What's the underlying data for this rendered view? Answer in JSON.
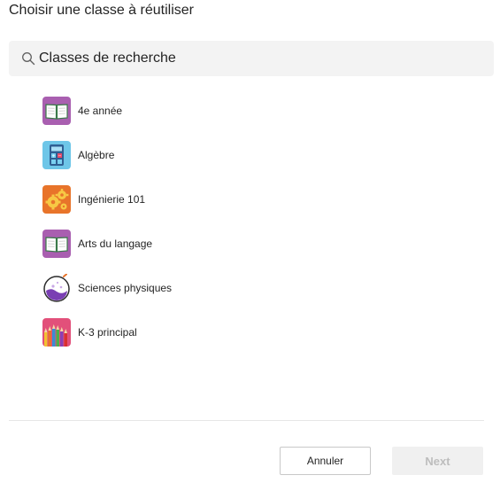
{
  "dialog": {
    "title": "Choisir une classe à réutiliser"
  },
  "search": {
    "placeholder": "Classes de recherche",
    "icon": "search-icon"
  },
  "classes": [
    {
      "label": "4e année",
      "icon": "open-book-icon",
      "color": "#a95fb0"
    },
    {
      "label": "Algèbre",
      "icon": "calculator-icon",
      "color": "#6ec6e8"
    },
    {
      "label": "Ingénierie 101",
      "icon": "gears-icon",
      "color": "#e8742a"
    },
    {
      "label": "Arts du langage",
      "icon": "open-book-icon",
      "color": "#a95fb0"
    },
    {
      "label": "Sciences physiques",
      "icon": "flask-icon",
      "color": "#6b3fa0"
    },
    {
      "label": "K-3 principal",
      "icon": "colored-pencils-icon",
      "color": "#e2507a"
    }
  ],
  "footer": {
    "cancel_label": "Annuler",
    "next_label": "Next"
  }
}
